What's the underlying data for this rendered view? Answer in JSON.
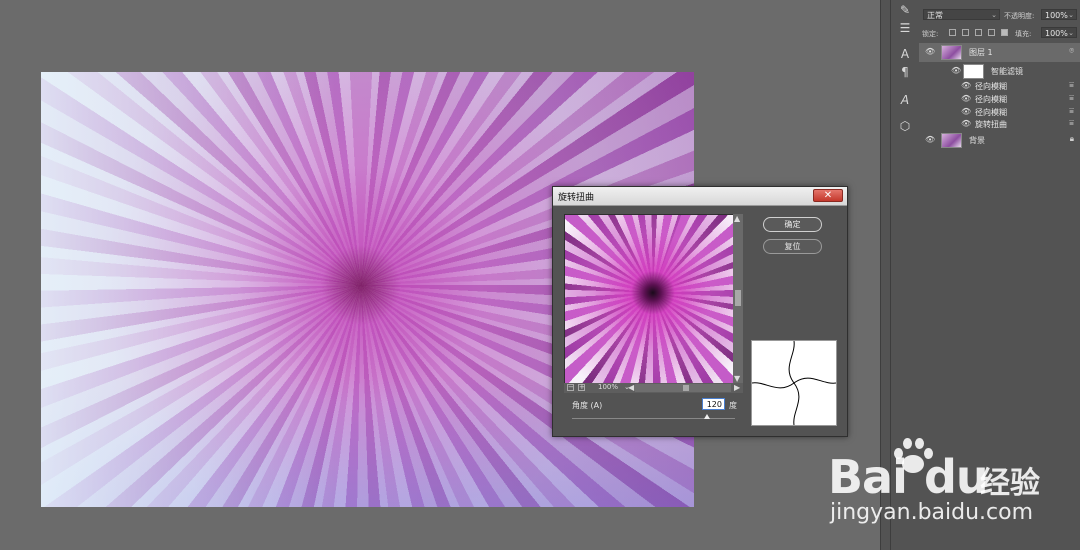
{
  "layers_panel": {
    "blend_mode": "正常",
    "opacity_label": "不透明度:",
    "opacity_value": "100%",
    "lock_label": "锁定:",
    "fill_label": "填充:",
    "fill_value": "100%",
    "layers": [
      {
        "name": "图层 1",
        "selected": true,
        "thumb": "flower",
        "right_icon": "smart-object-icon"
      },
      {
        "name": "智能滤镜",
        "thumb": "white"
      },
      {
        "name": "径向模糊",
        "right_icon": "filter-options-icon"
      },
      {
        "name": "径向模糊",
        "right_icon": "filter-options-icon"
      },
      {
        "name": "径向模糊",
        "right_icon": "filter-options-icon"
      },
      {
        "name": "旋转扭曲",
        "right_icon": "filter-options-icon"
      },
      {
        "name": "背景",
        "thumb": "flower",
        "right_icon": "lock-icon"
      }
    ]
  },
  "dialog": {
    "title": "旋转扭曲",
    "close_label": "✕",
    "ok_label": "确定",
    "reset_label": "复位",
    "zoom": "100%",
    "angle_label": "角度 (A)",
    "angle_value": "120",
    "angle_unit": "度",
    "angle_fraction": 0.83
  },
  "watermark": {
    "logo_bai": "Bai",
    "logo_du": "du",
    "logo_jingyan": "经验",
    "url": "jingyan.baidu.com"
  }
}
